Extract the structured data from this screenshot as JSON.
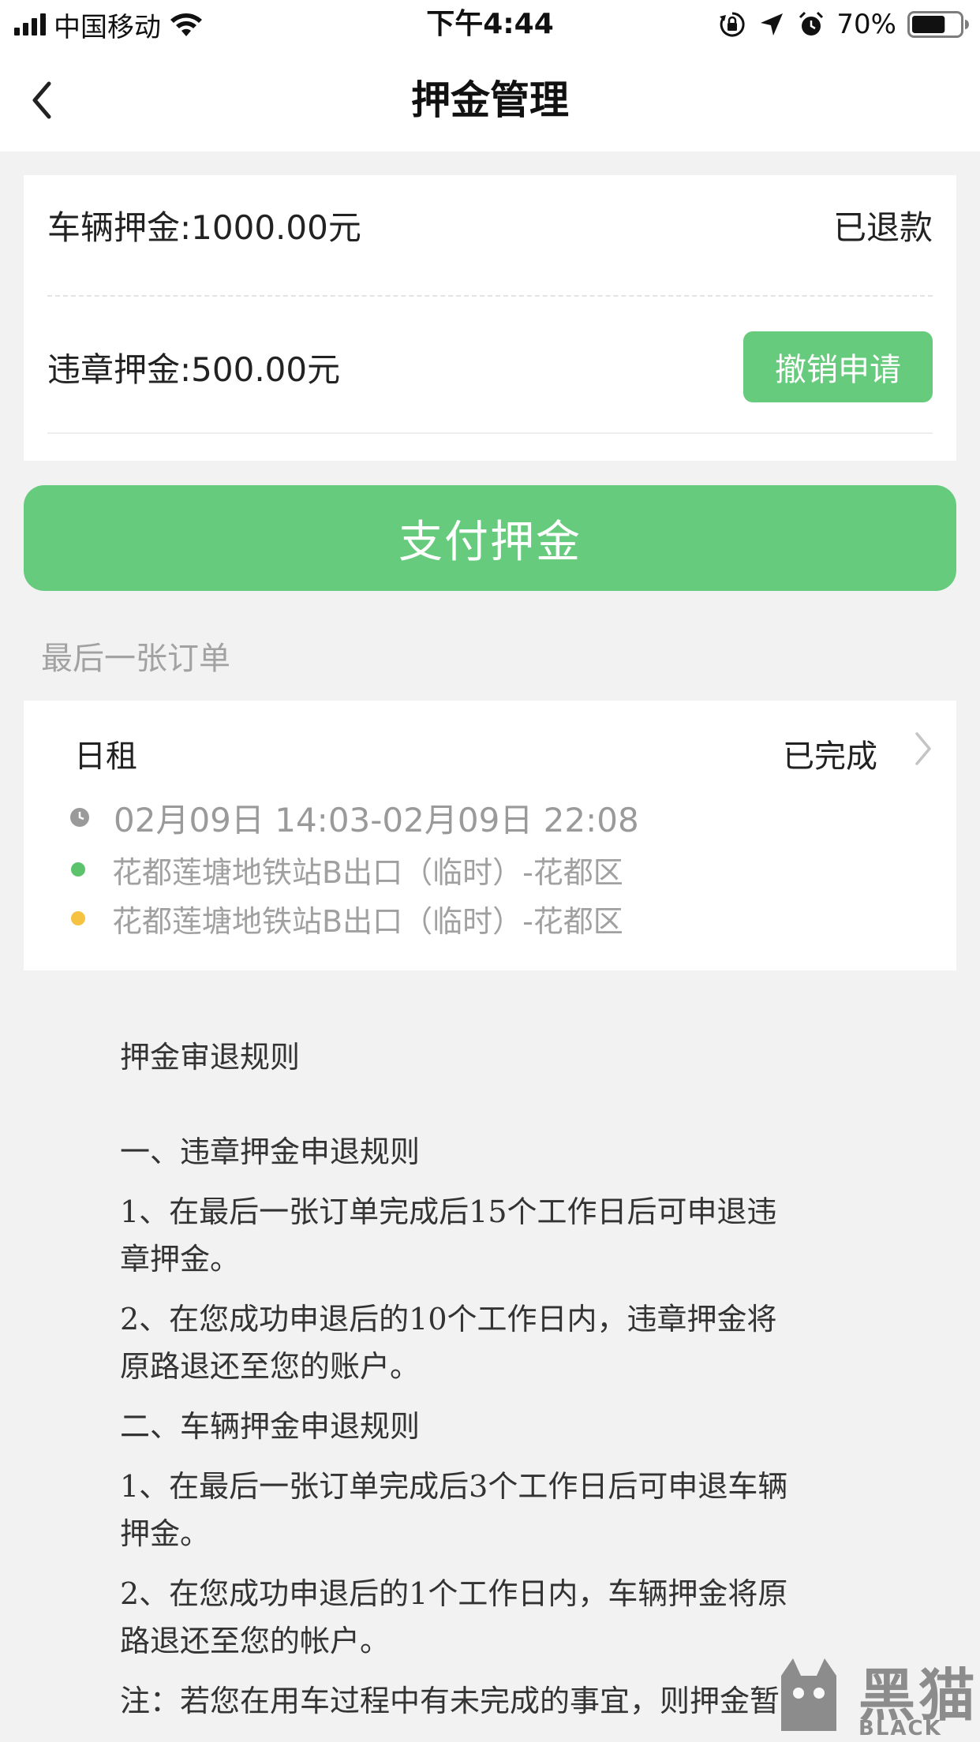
{
  "status_bar": {
    "carrier": "中国移动",
    "time": "下午4:44",
    "battery": "70%",
    "battery_level": 0.7,
    "icons": [
      "signal-icon",
      "wifi-icon",
      "orientation-lock-icon",
      "location-arrow-icon",
      "alarm-icon",
      "battery-icon"
    ]
  },
  "nav": {
    "title": "押金管理",
    "back_icon": "chevron-left-icon"
  },
  "deposits": {
    "vehicle_label": "车辆押金:1000.00元",
    "vehicle_status": "已退款",
    "violation_label": "违章押金:500.00元",
    "cancel_button": "撤销申请"
  },
  "pay_button": "支付押金",
  "last_order": {
    "section_label": "最后一张订单",
    "type": "日租",
    "status": "已完成",
    "time_range": "02月09日 14:03-02月09日 22:08",
    "pickup": "花都莲塘地铁站B出口（临时）-花都区",
    "return": "花都莲塘地铁站B出口（临时）-花都区",
    "pickup_dot_color": "#5cc26c",
    "return_dot_color": "#f5c242"
  },
  "rules": {
    "title": "押金审退规则",
    "section1_heading": "一、违章押金申退规则",
    "section1_item1_line1": "1、在最后一张订单完成后15个工作日后可申退违",
    "section1_item1_line2": "章押金。",
    "section1_item2_line1": "2、在您成功申退后的10个工作日内，违章押金将",
    "section1_item2_line2": "原路退还至您的账户。",
    "section2_heading": "二、车辆押金申退规则",
    "section2_item1_line1": "1、在最后一张订单完成后3个工作日后可申退车辆",
    "section2_item1_line2": "押金。",
    "section2_item2_line1": "2、在您成功申退后的1个工作日内，车辆押金将原",
    "section2_item2_line2": "路退还至您的帐户。",
    "note": "注：若您在用车过程中有未完成的事宜，则押金暂"
  },
  "watermark": {
    "text": "黑猫",
    "sub": "BLACK CAT"
  },
  "colors": {
    "accent": "#66cb7c",
    "background": "#f2f2f2"
  }
}
